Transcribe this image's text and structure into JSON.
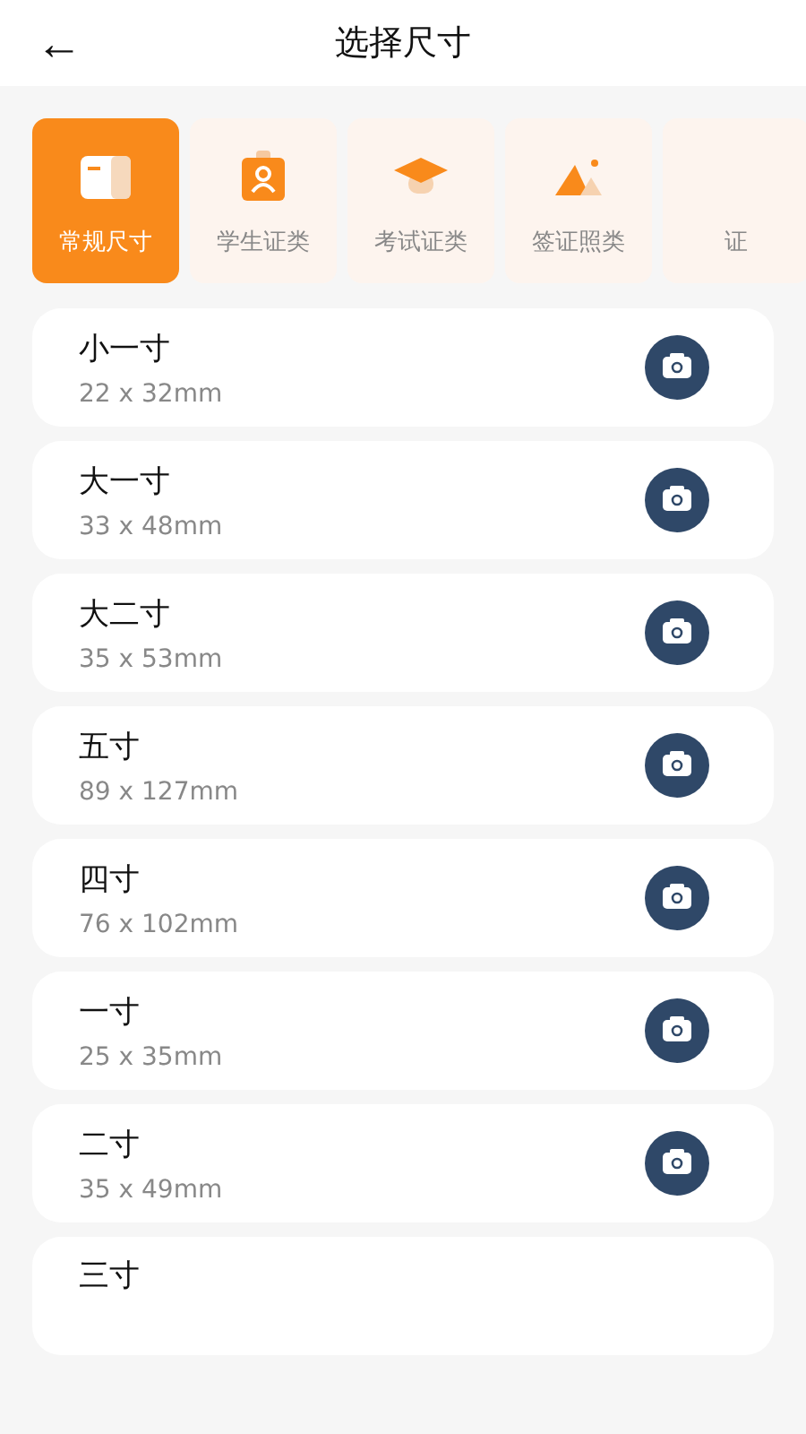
{
  "header": {
    "back": "←",
    "title": "选择尺寸"
  },
  "tabs": [
    {
      "label": "常规尺寸",
      "kind": "folder",
      "selected": true
    },
    {
      "label": "学生证类",
      "kind": "badge",
      "selected": false
    },
    {
      "label": "考试证类",
      "kind": "cap",
      "selected": false
    },
    {
      "label": "签证照类",
      "kind": "mountain",
      "selected": false
    },
    {
      "label": "证",
      "kind": "none",
      "selected": false
    }
  ],
  "sizes": [
    {
      "name": "小一寸",
      "dims": "22 x 32mm"
    },
    {
      "name": "大一寸",
      "dims": "33 x 48mm"
    },
    {
      "name": "大二寸",
      "dims": "35 x 53mm"
    },
    {
      "name": "五寸",
      "dims": "89 x 127mm"
    },
    {
      "name": "四寸",
      "dims": "76 x 102mm"
    },
    {
      "name": "一寸",
      "dims": "25 x 35mm"
    },
    {
      "name": "二寸",
      "dims": "35 x 49mm"
    },
    {
      "name": "三寸"
    }
  ]
}
